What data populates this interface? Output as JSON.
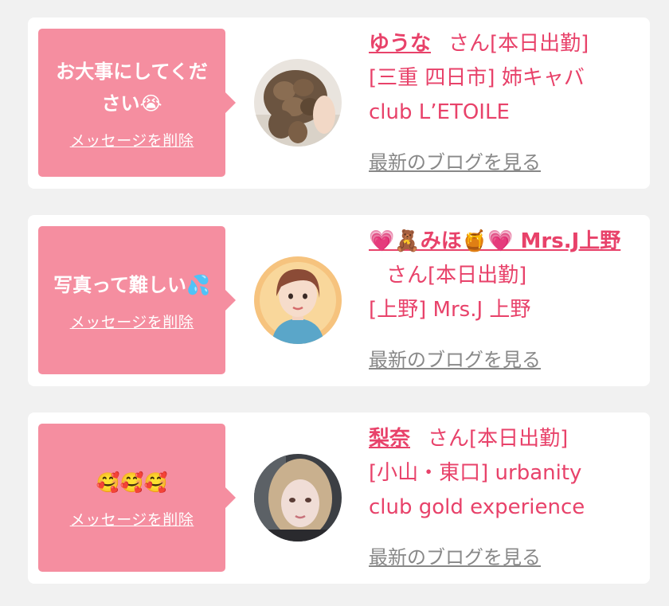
{
  "messages": [
    {
      "bubble_text": "お大事にしてください😭",
      "delete_label": "メッセージを削除",
      "name": "ゆうな",
      "suffix": "さん[本日出勤]",
      "area": "[三重 四日市] 姉キャバ",
      "shop": "club L’ETOILE",
      "blog_label": "最新のブログを見る",
      "avatar_icon": "hairstyle-photo"
    },
    {
      "bubble_text": "写真って難しい💦",
      "delete_label": "メッセージを削除",
      "name": "💗🧸みほ🍯💗 Mrs.J上野",
      "suffix": "さん[本日出勤]",
      "area": "[上野] Mrs.J 上野",
      "shop": "",
      "blog_label": "最新のブログを見る",
      "avatar_icon": "illustrated-woman"
    },
    {
      "bubble_text": "🥰🥰🥰",
      "delete_label": "メッセージを削除",
      "name": "梨奈",
      "suffix": "さん[本日出勤]",
      "area": "[小山・東口] urbanity",
      "shop": "club gold experience",
      "blog_label": "最新のブログを見る",
      "avatar_icon": "woman-photo"
    }
  ],
  "colors": {
    "bubble": "#f58ea0",
    "accent_text": "#e8426a",
    "link_gray": "#888888",
    "background": "#f1f1f1"
  }
}
